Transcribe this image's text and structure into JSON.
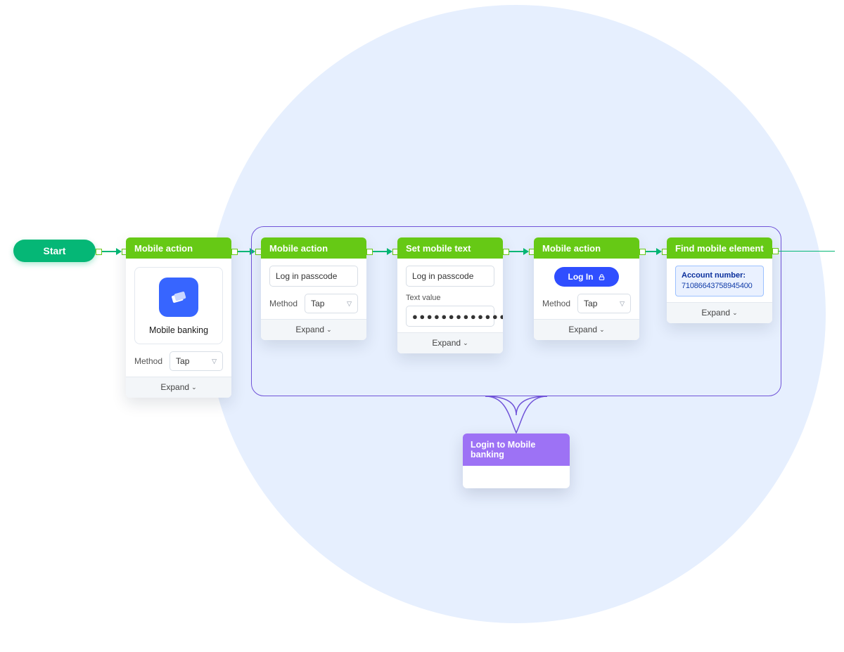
{
  "start": {
    "label": "Start"
  },
  "nodes": {
    "n1": {
      "title": "Mobile action",
      "app_name": "Mobile banking",
      "method_label": "Method",
      "method_value": "Tap",
      "expand": "Expand"
    },
    "n2": {
      "title": "Mobile action",
      "target": "Log in passcode",
      "method_label": "Method",
      "method_value": "Tap",
      "expand": "Expand"
    },
    "n3": {
      "title": "Set mobile text",
      "target": "Log in passcode",
      "textvalue_label": "Text value",
      "textvalue": "●●●●●●●●●●●●●●",
      "expand": "Expand"
    },
    "n4": {
      "title": "Mobile action",
      "button_text": "Log In",
      "method_label": "Method",
      "method_value": "Tap",
      "expand": "Expand"
    },
    "n5": {
      "title": "Find mobile element",
      "account_label": "Account number:",
      "account_number": "71086643758945400",
      "expand": "Expand"
    }
  },
  "group": {
    "label": "Login to Mobile banking"
  }
}
